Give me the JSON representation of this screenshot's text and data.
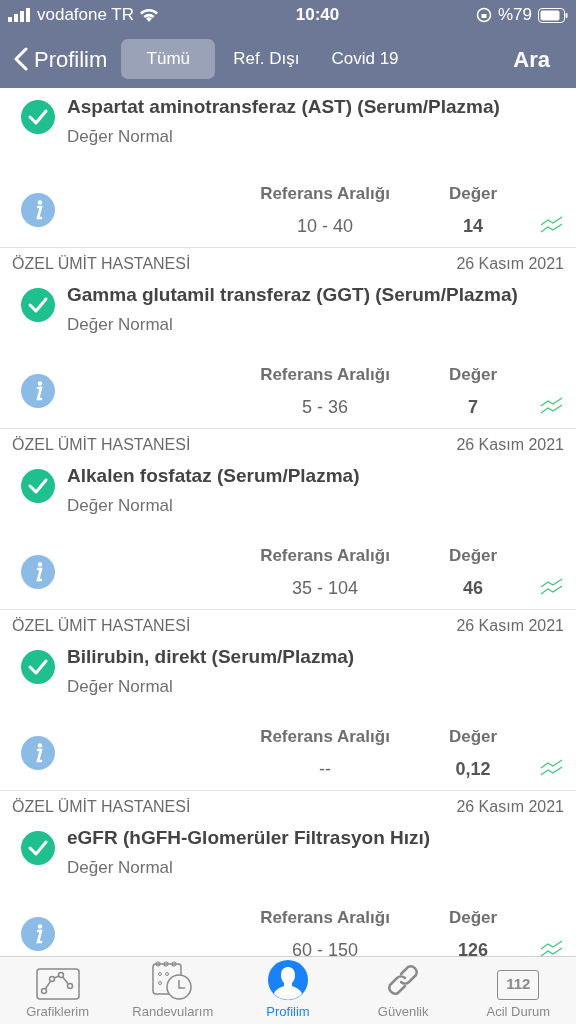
{
  "status_bar": {
    "carrier": "vodafone TR",
    "time": "10:40",
    "battery": "%79"
  },
  "nav": {
    "back": "Profilim",
    "segments": [
      {
        "label": "Tümü",
        "selected": true
      },
      {
        "label": "Ref. Dışı",
        "selected": false
      },
      {
        "label": "Covid 19",
        "selected": false
      }
    ],
    "action": "Ara"
  },
  "results": [
    {
      "title": "Aspartat aminotransferaz (AST) (Serum/Plazma)",
      "status": "Değer Normal",
      "normal": true,
      "range_label": "Referans Aralığı",
      "value_label": "Değer",
      "range": "10 - 40",
      "value": "14"
    },
    {
      "hospital": "ÖZEL ÜMİT HASTANESİ",
      "date": "26 Kasım 2021",
      "title": "Gamma glutamil transferaz (GGT) (Serum/Plazma)",
      "status": "Değer Normal",
      "normal": true,
      "range_label": "Referans Aralığı",
      "value_label": "Değer",
      "range": "5 - 36",
      "value": "7"
    },
    {
      "hospital": "ÖZEL ÜMİT HASTANESİ",
      "date": "26 Kasım 2021",
      "title": "Alkalen fosfataz (Serum/Plazma)",
      "status": "Değer Normal",
      "normal": true,
      "range_label": "Referans Aralığı",
      "value_label": "Değer",
      "range": "35 - 104",
      "value": "46"
    },
    {
      "hospital": "ÖZEL ÜMİT HASTANESİ",
      "date": "26 Kasım 2021",
      "title": "Bilirubin, direkt (Serum/Plazma)",
      "status": "Değer Normal",
      "normal": true,
      "range_label": "Referans Aralığı",
      "value_label": "Değer",
      "range": "--",
      "value": "0,12"
    },
    {
      "hospital": "ÖZEL ÜMİT HASTANESİ",
      "date": "26 Kasım 2021",
      "title": "eGFR (hGFH-Glomerüler Filtrasyon Hızı)",
      "status": "Değer Normal",
      "normal": true,
      "range_label": "Referans Aralığı",
      "value_label": "Değer",
      "range": "60 - 150",
      "value": "126"
    }
  ],
  "tab_bar": [
    {
      "label": "Grafiklerim",
      "kind": "chart",
      "selected": false
    },
    {
      "label": "Randevularım",
      "kind": "calendar",
      "selected": false
    },
    {
      "label": "Profilim",
      "kind": "person",
      "selected": true
    },
    {
      "label": "Güvenlik",
      "kind": "link",
      "selected": false
    },
    {
      "label": "Acil Durum",
      "kind": "emergency",
      "badge": "112",
      "selected": false
    }
  ]
}
